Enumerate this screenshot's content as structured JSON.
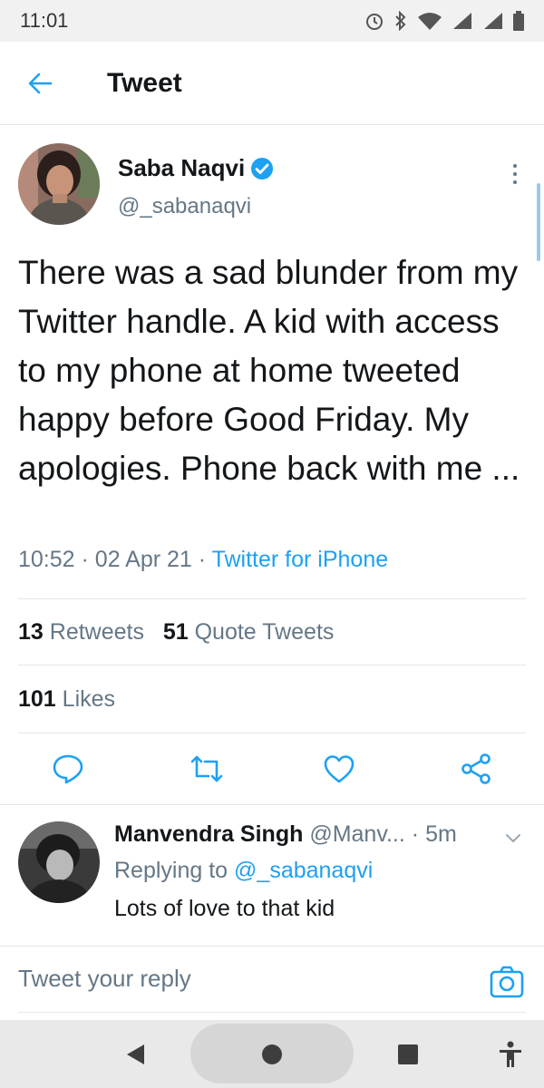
{
  "status_bar": {
    "time": "11:01"
  },
  "app_bar": {
    "title": "Tweet"
  },
  "tweet": {
    "author_name": "Saba Naqvi",
    "author_handle": "@_sabanaqvi",
    "verified": true,
    "text": "There was a sad blunder from my Twitter handle. A kid with access to my phone at home tweeted happy before Good Friday. My apologies. Phone back with me ...",
    "time": "10:52",
    "date": "02 Apr 21",
    "separator": "·",
    "source": "Twitter for iPhone",
    "retweets_count": "13",
    "retweets_label": "Retweets",
    "quote_tweets_count": "51",
    "quote_tweets_label": "Quote Tweets",
    "likes_count": "101",
    "likes_label": "Likes"
  },
  "reply": {
    "name": "Manvendra Singh",
    "handle": "@Manv...",
    "separator": "·",
    "time": "5m",
    "replying_to_label": "Replying to",
    "replying_to_handle": "@_sabanaqvi",
    "text": "Lots of love to that kid"
  },
  "compose": {
    "placeholder": "Tweet your reply"
  },
  "colors": {
    "accent": "#1da1f2",
    "secondary_text": "#657786",
    "divider": "#e1e8ed"
  }
}
